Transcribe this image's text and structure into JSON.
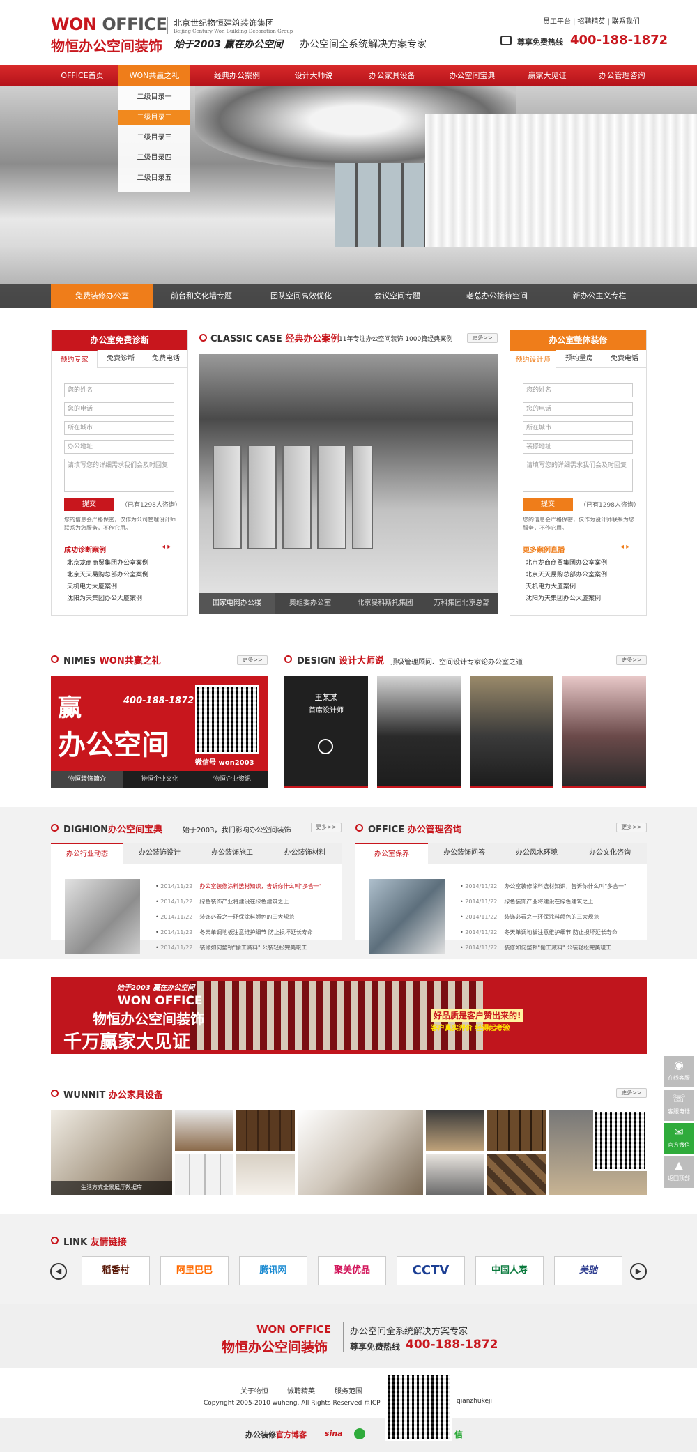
{
  "header": {
    "logo_en_a": "W",
    "logo_en_o": "O",
    "logo_en_b": "N",
    "logo_en_c": "OFFICE",
    "logo_cn": "物恒办公空间装饰",
    "group_cn": "北京世纪物恒建筑装饰集团",
    "group_en": "Beijing Century Won Building Decoration Group",
    "slogan": "始于2003  赢在办公空间",
    "slogan2": "办公空间全系统解决方案专家",
    "toplinks": [
      "员工平台",
      "招聘精英",
      "联系我们"
    ],
    "hotline_label": "尊享免费热线",
    "hotline_number": "400-188-1872"
  },
  "nav": {
    "items": [
      "OFFICE首页",
      "WON共赢之礼",
      "经典办公案例",
      "设计大师说",
      "办公家具设备",
      "办公空间宝典",
      "赢家大见证",
      "办公管理咨询"
    ],
    "active_index": 1,
    "dropdown": [
      "二级目录一",
      "二级目录二",
      "二级目录三",
      "二级目录四",
      "二级目录五"
    ],
    "dropdown_active": 1
  },
  "hero": {
    "tabs": [
      "免费装修办公室",
      "前台和文化墙专题",
      "团队空间高效优化",
      "会议空间专题",
      "老总办公接待空间",
      "新办公主义专栏"
    ],
    "active_index": 0
  },
  "left_box": {
    "title": "办公室免费诊断",
    "tabs": [
      "预约专家",
      "免费诊断",
      "免费电话"
    ],
    "fields": [
      "您的姓名",
      "您的电话",
      "所在城市",
      "办公地址"
    ],
    "textarea": "请填写您的详细需求我们会及时回复",
    "submit": "提交",
    "count": "（已有1298人咨询）",
    "note": "您的信息会严格保密，仅作为公司管理设计师联系为您服务，不作它用。",
    "list_title": "成功诊断案例",
    "list": [
      "北京龙商商贸集团办公室案例",
      "北京天天易购总部办公室案例",
      "天机电力大厦案例",
      "沈阳为天集团办公大厦案例"
    ]
  },
  "right_box": {
    "title": "办公室整体装修",
    "tabs": [
      "预约设计师",
      "预约量房",
      "免费电话"
    ],
    "fields": [
      "您的姓名",
      "您的电话",
      "所在城市",
      "装修地址"
    ],
    "textarea": "请填写您的详细需求我们会及时回复",
    "submit": "提交",
    "count": "（已有1298人咨询）",
    "note": "您的信息会严格保密，仅作为设计师联系为您服务，不作它用。",
    "list_title": "更多案例直播",
    "list": [
      "北京龙商商贸集团办公室案例",
      "北京天天易购总部办公室案例",
      "天机电力大厦案例",
      "沈阳为天集团办公大厦案例"
    ]
  },
  "classic": {
    "title_en": "CLASSIC CASE",
    "title_cn": "经典办公案例",
    "subtitle": "11年专注办公空间装饰  1000篇经典案例",
    "more": "更多>>",
    "tabs": [
      "国家电网办公楼",
      "奥组委办公室",
      "北京曼科斯托集团",
      "万科集团北京总部"
    ],
    "active_index": 0
  },
  "nimes": {
    "title_en": "NIMES",
    "title_cn": "WON共赢之礼",
    "more": "更多>>",
    "banner_win": "赢",
    "banner_phone": "400-188-1872",
    "banner_main": "办公空间",
    "banner_wx": "微信号 won2003",
    "tabs": [
      "物恒装饰简介",
      "物恒企业文化",
      "物恒企业资讯"
    ]
  },
  "design": {
    "title_en": "DESIGN",
    "title_cn": "设计大师说",
    "subtitle": "顶级管理顾问、空间设计专家论办公室之道",
    "more": "更多>>",
    "card_name": "王某某",
    "card_role": "首席设计师"
  },
  "dighion": {
    "title_en": "DIGHION",
    "title_cn": "办公空间宝典",
    "subtitle": "始于2003，我们影响办公空间装饰",
    "more": "更多>>",
    "tabs": [
      "办公行业动态",
      "办公装饰设计",
      "办公装饰施工",
      "办公装饰材料"
    ],
    "news": [
      {
        "date": "2014/11/22",
        "text": "办公室装修涂料选材知识，告诉你什么叫\"多合一\""
      },
      {
        "date": "2014/11/22",
        "text": "绿色装饰产业将建设在绿色建筑之上"
      },
      {
        "date": "2014/11/22",
        "text": "装饰必看之一环保涂料颜色的三大规范"
      },
      {
        "date": "2014/11/22",
        "text": "冬天单调地板注意维护细节  防止损坏延长寿命"
      },
      {
        "date": "2014/11/22",
        "text": "装修如何整顿\"偷工减料\" 公装轻松完美竣工"
      }
    ]
  },
  "office": {
    "title_en": "OFFICE",
    "title_cn": "办公管理咨询",
    "more": "更多>>",
    "tabs": [
      "办公室保养",
      "办公装饰问答",
      "办公风水环境",
      "办公文化咨询"
    ],
    "news": [
      {
        "date": "2014/11/22",
        "text": "办公室装修涂料选材知识，告诉你什么叫\"多合一\""
      },
      {
        "date": "2014/11/22",
        "text": "绿色装饰产业将建设在绿色建筑之上"
      },
      {
        "date": "2014/11/22",
        "text": "装饰必看之一环保涂料颜色的三大规范"
      },
      {
        "date": "2014/11/22",
        "text": "冬天单调地板注意维护细节  防止损坏延长寿命"
      },
      {
        "date": "2014/11/22",
        "text": "装修如何整顿\"偷工减料\" 公装轻松完美竣工"
      }
    ]
  },
  "ad": {
    "t1": "始于2003  赢在办公空间",
    "t2": "WON OFFICE",
    "t3": "物恒办公空间装饰",
    "t4": "千万赢家大见证",
    "t5": "好品质是客户赞出来的!",
    "t6": "客户真实评价  经得起考验"
  },
  "wunnit": {
    "title_en": "WUNNIT",
    "title_cn": "办公家具设备",
    "more": "更多>>",
    "caption": "生活方式全景展厅数据库"
  },
  "links": {
    "title_en": "LINK",
    "title_cn": "友情链接",
    "logos": [
      "稻香村",
      "阿里巴巴",
      "腾讯网",
      "聚美优品",
      "CCTV",
      "中国人寿",
      "美驰"
    ]
  },
  "footer": {
    "logo_en": "WON OFFICE",
    "logo_cn": "物恒办公空间装饰",
    "slogan": "办公空间全系统解决方案专家",
    "hotline_label": "尊享免费热线",
    "hotline_number": "400-188-1872",
    "links": [
      "关于物恒",
      "诚聘精英",
      "服务范围"
    ],
    "copyright": "Copyright 2005-2010 wuheng. All Rights Reserved 京ICP",
    "copyright_tail": "qianzhukeji",
    "blog_a": "办公装修",
    "blog_b": "官方博客",
    "blog_c": "sina",
    "wechat": "信"
  },
  "side": [
    "在线客服",
    "客服电话",
    "官方微信",
    "返回顶部"
  ],
  "colors": {
    "brand_red": "#c8161d",
    "accent_orange": "#ef7d1a"
  }
}
